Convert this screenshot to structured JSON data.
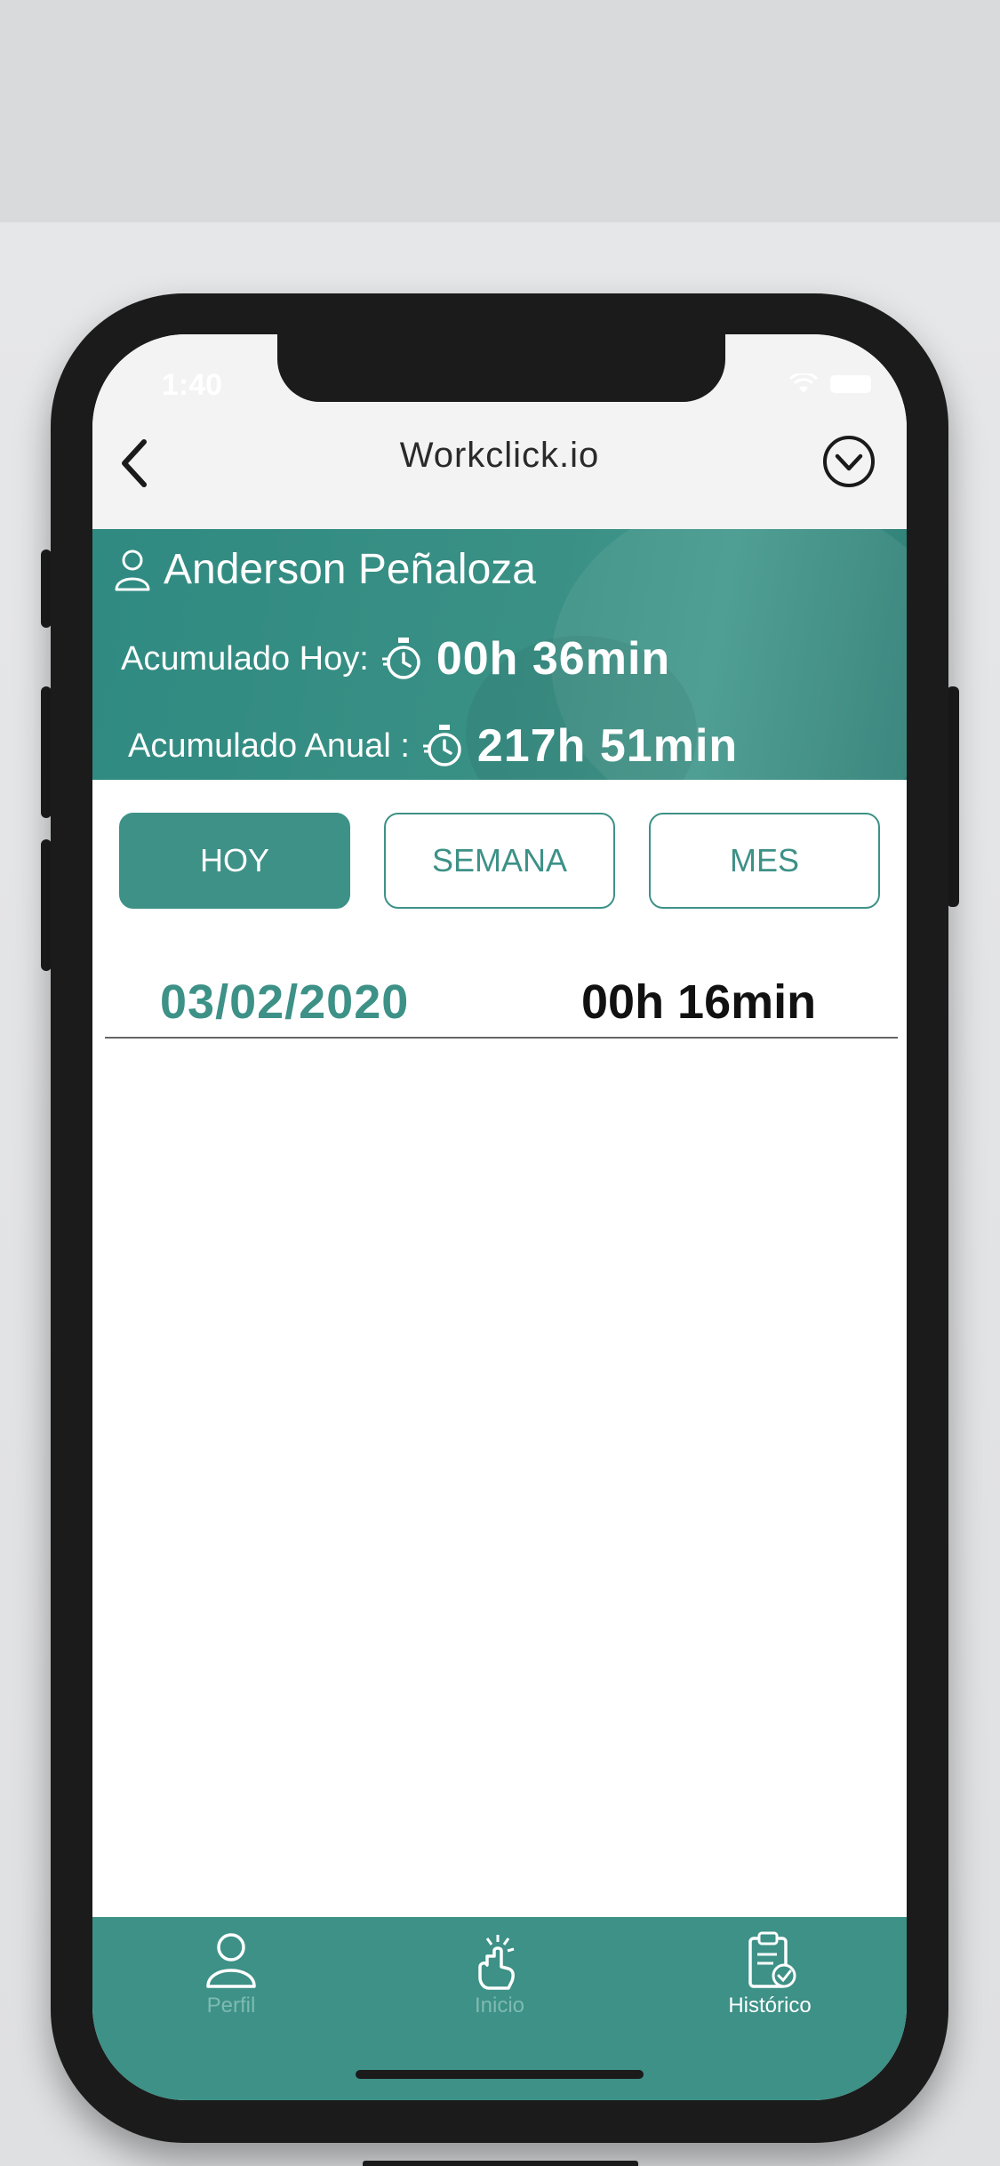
{
  "status_bar": {
    "time": "1:40"
  },
  "navbar": {
    "title": "Workclick.io"
  },
  "banner": {
    "user_name": "Anderson Peñaloza",
    "today_label": "Acumulado Hoy:",
    "today_value": "00h 36min",
    "annual_label": "Acumulado Anual :",
    "annual_value": "217h 51min"
  },
  "tabs": [
    {
      "label": "HOY",
      "active": true
    },
    {
      "label": "SEMANA",
      "active": false
    },
    {
      "label": "MES",
      "active": false
    }
  ],
  "entries": [
    {
      "date": "03/02/2020",
      "duration": "00h 16min"
    }
  ],
  "bottom_nav": [
    {
      "label": "Perfil",
      "icon": "user-icon",
      "active": false
    },
    {
      "label": "Inicio",
      "icon": "tap-hand-icon",
      "active": false
    },
    {
      "label": "Histórico",
      "icon": "clipboard-check-icon",
      "active": true
    }
  ],
  "colors": {
    "accent": "#3d9187",
    "banner": "#3a9085",
    "inactive_nav_label": "#7fbab2",
    "active_nav_label": "#ffffff"
  }
}
